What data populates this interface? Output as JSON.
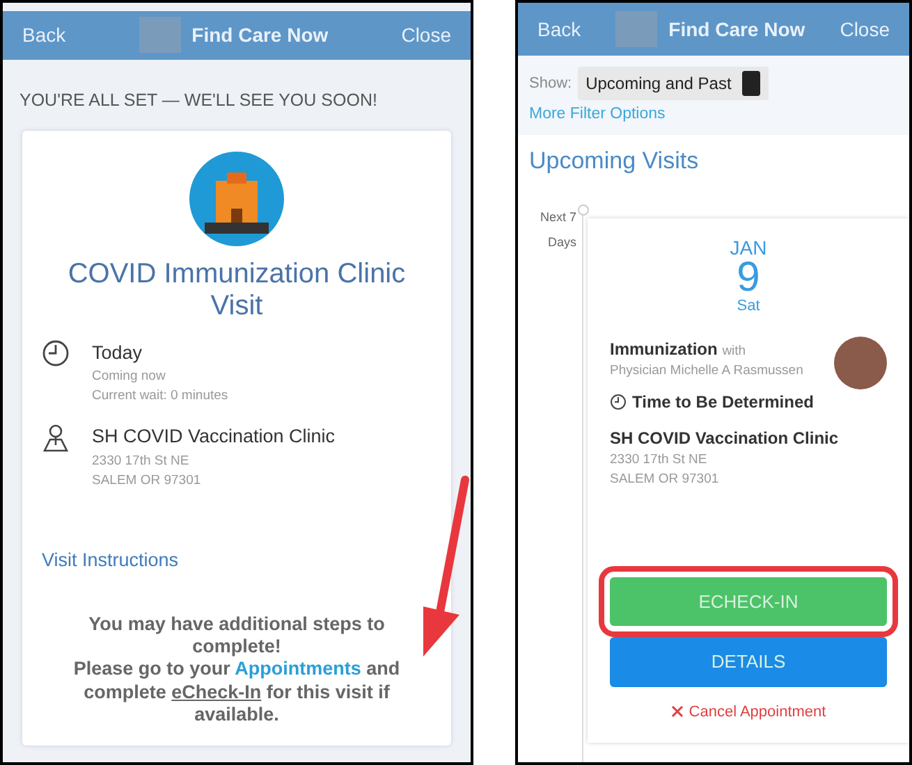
{
  "left_screen": {
    "header": {
      "back": "Back",
      "title": "Find Care Now",
      "close": "Close"
    },
    "banner": "YOU'RE ALL SET — WE'LL SEE YOU SOON!",
    "visit_title": "COVID Immunization Clinic Visit",
    "time": {
      "label": "Today",
      "status": "Coming now",
      "wait": "Current wait: 0 minutes"
    },
    "location": {
      "name": "SH COVID Vaccination Clinic",
      "street": "2330 17th St NE",
      "city": "SALEM OR 97301"
    },
    "instructions_link": "Visit Instructions",
    "notice": {
      "line_1": "You may have additional steps to complete!",
      "before_link": "Please go to your",
      "link": "Appointments",
      "after_link": "and complete",
      "underlined": "eCheck-In",
      "end": "for this visit if available."
    }
  },
  "right_screen": {
    "header": {
      "back": "Back",
      "title": "Find Care Now",
      "close": "Close"
    },
    "filter": {
      "label": "Show:",
      "value": "Upcoming and Past",
      "more": "More Filter Options"
    },
    "heading": "Upcoming Visits",
    "timeline_label": "Next 7 Days",
    "visit": {
      "month": "JAN",
      "day": "9",
      "weekday": "Sat",
      "type": "Immunization",
      "with": "with",
      "provider": "Physician Michelle A Rasmussen",
      "time": "Time to Be Determined",
      "location": "SH COVID Vaccination Clinic",
      "street": "2330 17th St NE",
      "city": "SALEM OR 97301",
      "buttons": [
        {
          "label": "ECHECK-IN",
          "kind": "success",
          "highlighted": true
        },
        {
          "label": "DETAILS",
          "kind": "primary",
          "highlighted": false
        }
      ],
      "cancel": "Cancel Appointment"
    }
  }
}
